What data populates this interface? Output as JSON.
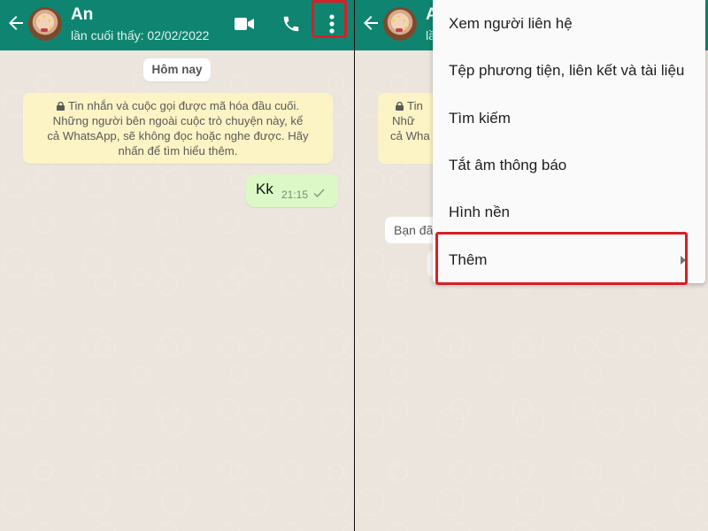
{
  "contact": {
    "name": "An",
    "last_seen": "lần cuối thấy: 02/02/2022",
    "name_partial": "A",
    "last_seen_partial": "lầ"
  },
  "header_icons": [
    "back-arrow-icon",
    "video-call-icon",
    "voice-call-icon",
    "more-options-icon"
  ],
  "chat": {
    "date_chip": "Hôm nay",
    "encryption_notice": [
      "Tin nhắn và cuộc gọi được mã hóa đầu cuối.",
      "Những người bên ngoài cuộc trò chuyện này, kể",
      "cả WhatsApp, sẽ không đọc hoặc nghe được. Hãy",
      "nhấn để tìm hiểu thêm."
    ],
    "encryption_notice_partial": [
      "Tin",
      "Nhữ",
      "cả Wha"
    ],
    "outgoing_message": {
      "text": "Kk",
      "time": "21:15"
    },
    "partial_chip": "Bạn đã"
  },
  "overflow_menu": {
    "items": [
      {
        "label": "Xem người liên hệ"
      },
      {
        "label": "Tệp phương tiện, liên kết và tài liệu"
      },
      {
        "label": "Tìm kiếm"
      },
      {
        "label": "Tắt âm thông báo"
      },
      {
        "label": "Hình nền"
      },
      {
        "label": "Thêm",
        "has_submenu": true
      }
    ]
  },
  "colors": {
    "header": "#0f8571",
    "chat_bg": "#ece5dd",
    "outgoing_bubble": "#dcf8c6",
    "notice_bg": "#fdf4c5",
    "highlight": "#d61f26"
  }
}
